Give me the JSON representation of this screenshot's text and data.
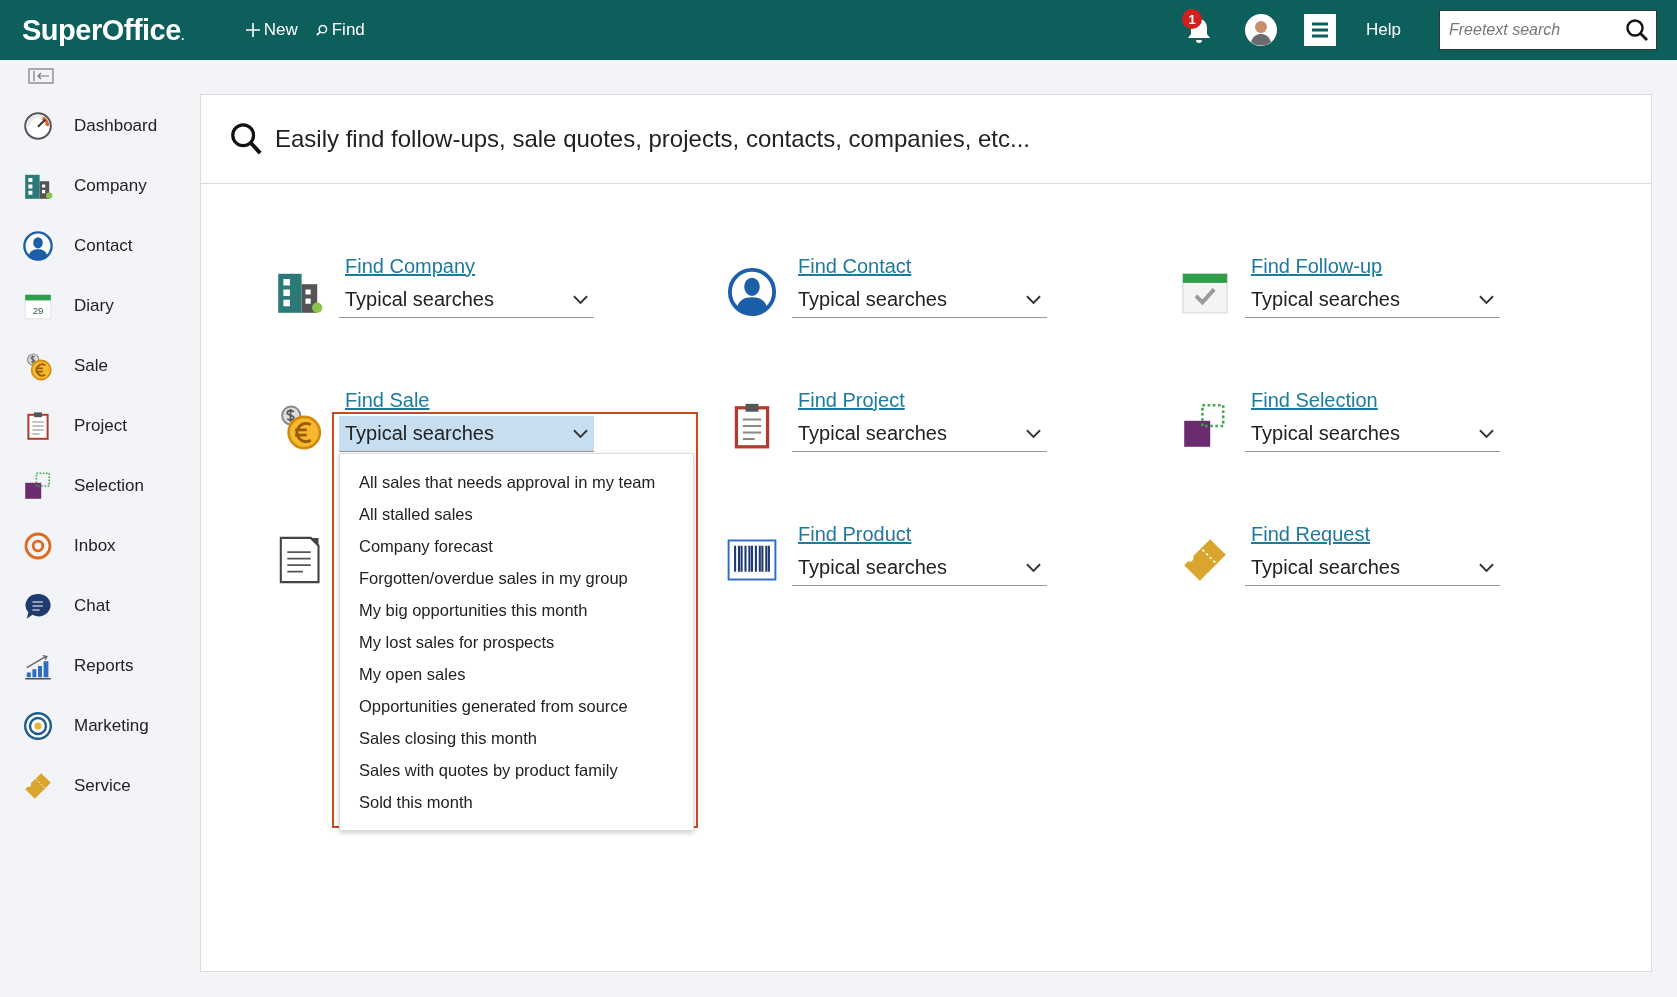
{
  "topbar": {
    "logo": "SuperOffice",
    "logo_mark": ".",
    "actions": [
      {
        "kind": "plus",
        "label": "New"
      },
      {
        "kind": "search",
        "label": "Find"
      }
    ],
    "notifications": "1",
    "help": "Help",
    "search": {
      "placeholder": "Freetext search"
    }
  },
  "sidebar": {
    "items": [
      {
        "kind": "dashboard",
        "label": "Dashboard"
      },
      {
        "kind": "company",
        "label": "Company"
      },
      {
        "kind": "contact",
        "label": "Contact"
      },
      {
        "kind": "diary",
        "label": "Diary",
        "icon_text": "29"
      },
      {
        "kind": "sale",
        "label": "Sale"
      },
      {
        "kind": "project",
        "label": "Project"
      },
      {
        "kind": "selection",
        "label": "Selection"
      },
      {
        "kind": "inbox",
        "label": "Inbox"
      },
      {
        "kind": "chat",
        "label": "Chat"
      },
      {
        "kind": "reports",
        "label": "Reports"
      },
      {
        "kind": "marketing",
        "label": "Marketing"
      },
      {
        "kind": "service",
        "label": "Service"
      }
    ]
  },
  "header": {
    "text": "Easily find follow-ups, sale quotes, projects, contacts, companies, etc..."
  },
  "finders": [
    {
      "kind": "company",
      "link": "Find Company",
      "value": "Typical searches",
      "open": false
    },
    {
      "kind": "contact",
      "link": "Find Contact",
      "value": "Typical searches",
      "open": false
    },
    {
      "kind": "followup",
      "link": "Find Follow-up",
      "value": "Typical searches",
      "open": false
    },
    {
      "kind": "sale",
      "link": "Find Sale",
      "value": "Typical searches",
      "open": true,
      "options": [
        "All sales that needs approval in my team",
        "All stalled sales",
        "Company forecast",
        "Forgotten/overdue sales in my group",
        "My big opportunities this month",
        "My lost sales for prospects",
        "My open sales",
        "Opportunities generated from source",
        "Sales closing this month",
        "Sales with quotes by product family",
        "Sold this month"
      ]
    },
    {
      "kind": "project",
      "link": "Find Project",
      "value": "Typical searches",
      "open": false
    },
    {
      "kind": "selection",
      "link": "Find Selection",
      "value": "Typical searches",
      "open": false
    },
    {
      "kind": "document"
    },
    {
      "kind": "product",
      "link": "Find Product",
      "value": "Typical searches",
      "open": false
    },
    {
      "kind": "service",
      "link": "Find Request",
      "value": "Typical searches",
      "open": false
    }
  ]
}
